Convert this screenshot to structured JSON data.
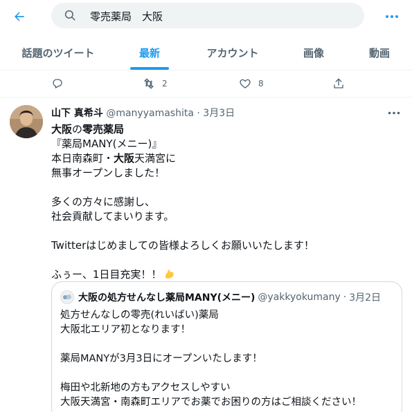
{
  "search": {
    "query": "零売薬局　大阪"
  },
  "tabs": [
    {
      "label": "話題のツイート"
    },
    {
      "label": "最新"
    },
    {
      "label": "アカウント"
    },
    {
      "label": "画像"
    },
    {
      "label": "動画"
    }
  ],
  "active_tab": "最新",
  "prev_tweet": {
    "retweets": "2",
    "likes": "8"
  },
  "tweet": {
    "name": "山下 真希斗",
    "handle": "@manyyamashita",
    "dot": "·",
    "date": "3月3日",
    "lines": {
      "l1a": "大阪",
      "l1b": "の",
      "l1c": "零売薬局",
      "l2": "『薬局MANY(メニー)』",
      "l3a": "本日南森町・",
      "l3b": "大阪",
      "l3c": "天満宮に",
      "l4": "無事オープンしました！",
      "l5": "多くの方々に感謝し、",
      "l6": "社会貢献してまいります。",
      "l7": "Twitterはじめましての皆様よろしくお願いいたします！",
      "l8": "ふぅー、1日目充実！！"
    },
    "emoji": "flexed-biceps"
  },
  "quote": {
    "name": "大阪の処方せんなし薬局MANY(メニー)",
    "handle": "@yakkyokumany",
    "dot": "·",
    "date": "3月2日",
    "lines": {
      "q1": "処方せんなしの零売(れいばい)薬局",
      "q2": "大阪北エリア初となります！",
      "q3": "薬局MANYが3月3日にオープンいたします！",
      "q4": "梅田や北新地の方もアクセスしやすい",
      "q5": "大阪天満宮・南森町エリアでお薬でお困りの方はご相談ください！"
    }
  },
  "colors": {
    "accent": "#1d9bf0",
    "muted": "#536471",
    "text": "#0f1419",
    "border": "#cfd9de",
    "search_bg": "#eff3f4"
  }
}
